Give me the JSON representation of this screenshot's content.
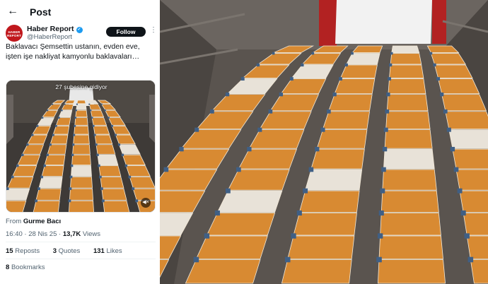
{
  "header": {
    "back_glyph": "←",
    "title": "Post"
  },
  "account": {
    "name": "Haber Report",
    "handle": "@HaberReport",
    "avatar_text": "HABER REPORT",
    "follow_label": "Follow",
    "more_glyph": "⋮",
    "verified_glyph": "✓"
  },
  "post": {
    "text": "Baklavacı Şemsettin ustanın, evden eve, işten işe nakliyat kamyonlu baklavaları…",
    "media_caption": "27 şubesine gidiyor",
    "from_label": "From",
    "from_name": "Gurme Bacı",
    "time": "16:40",
    "date": "28 Nis 25",
    "views_count": "13,7K",
    "views_label": "Views"
  },
  "stats": {
    "reposts_count": "15",
    "reposts_label": "Reposts",
    "quotes_count": "3",
    "quotes_label": "Quotes",
    "likes_count": "131",
    "likes_label": "Likes",
    "bookmarks_count": "8",
    "bookmarks_label": "Bookmarks"
  },
  "colors": {
    "accent": "#1d9bf0",
    "brand_red": "#c0181d",
    "tray_orange": "#d88a32"
  },
  "icons": {
    "back": "arrow-left-icon",
    "verified": "verified-badge-icon",
    "more": "more-vertical-icon",
    "mute": "speaker-muted-icon"
  }
}
